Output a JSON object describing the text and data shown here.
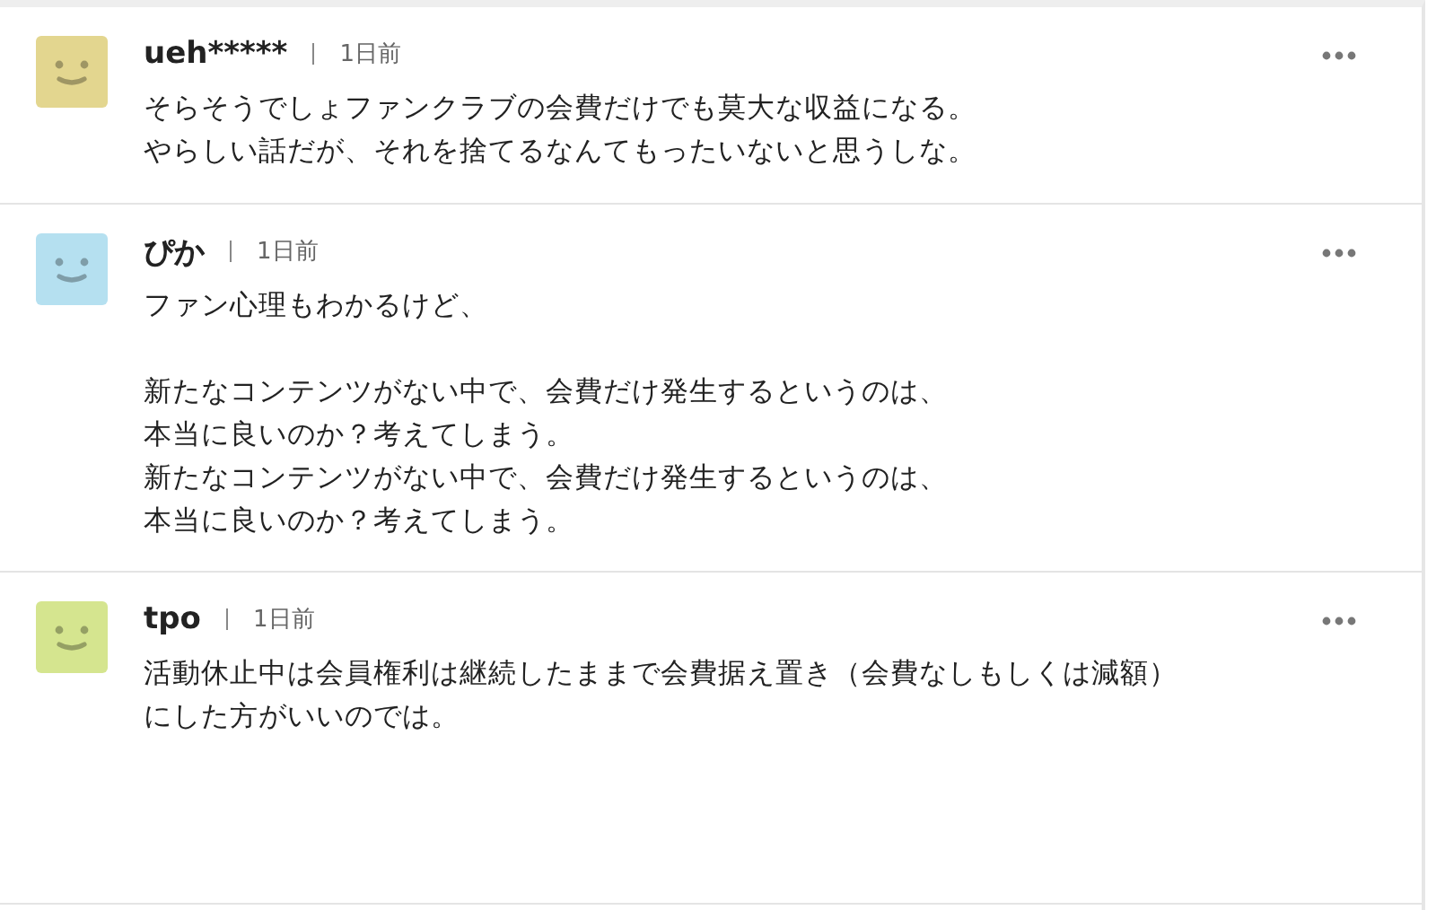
{
  "comments": [
    {
      "user": "ueh*****",
      "time": "1日前",
      "color": "#e3d68f",
      "paragraphs": [
        [
          "そらそうでしょファンクラブの会費だけでも莫大な収益になる。",
          "やらしい話だが、それを捨てるなんてもったいないと思うしな。"
        ]
      ]
    },
    {
      "user": "ぴか",
      "time": "1日前",
      "color": "#b5e0f0",
      "paragraphs": [
        [
          "ファン心理もわかるけど、"
        ],
        [
          "新たなコンテンツがない中で、会費だけ発生するというのは、",
          "本当に良いのか？考えてしまう。",
          "新たなコンテンツがない中で、会費だけ発生するというのは、",
          "本当に良いのか？考えてしまう。"
        ]
      ]
    },
    {
      "user": "tpo",
      "time": "1日前",
      "color": "#d5e58f",
      "paragraphs": [
        [
          "活動休止中は会員権利は継続したままで会費据え置き（会費なしもしくは減額）",
          "にした方がいいのでは。"
        ]
      ]
    }
  ]
}
